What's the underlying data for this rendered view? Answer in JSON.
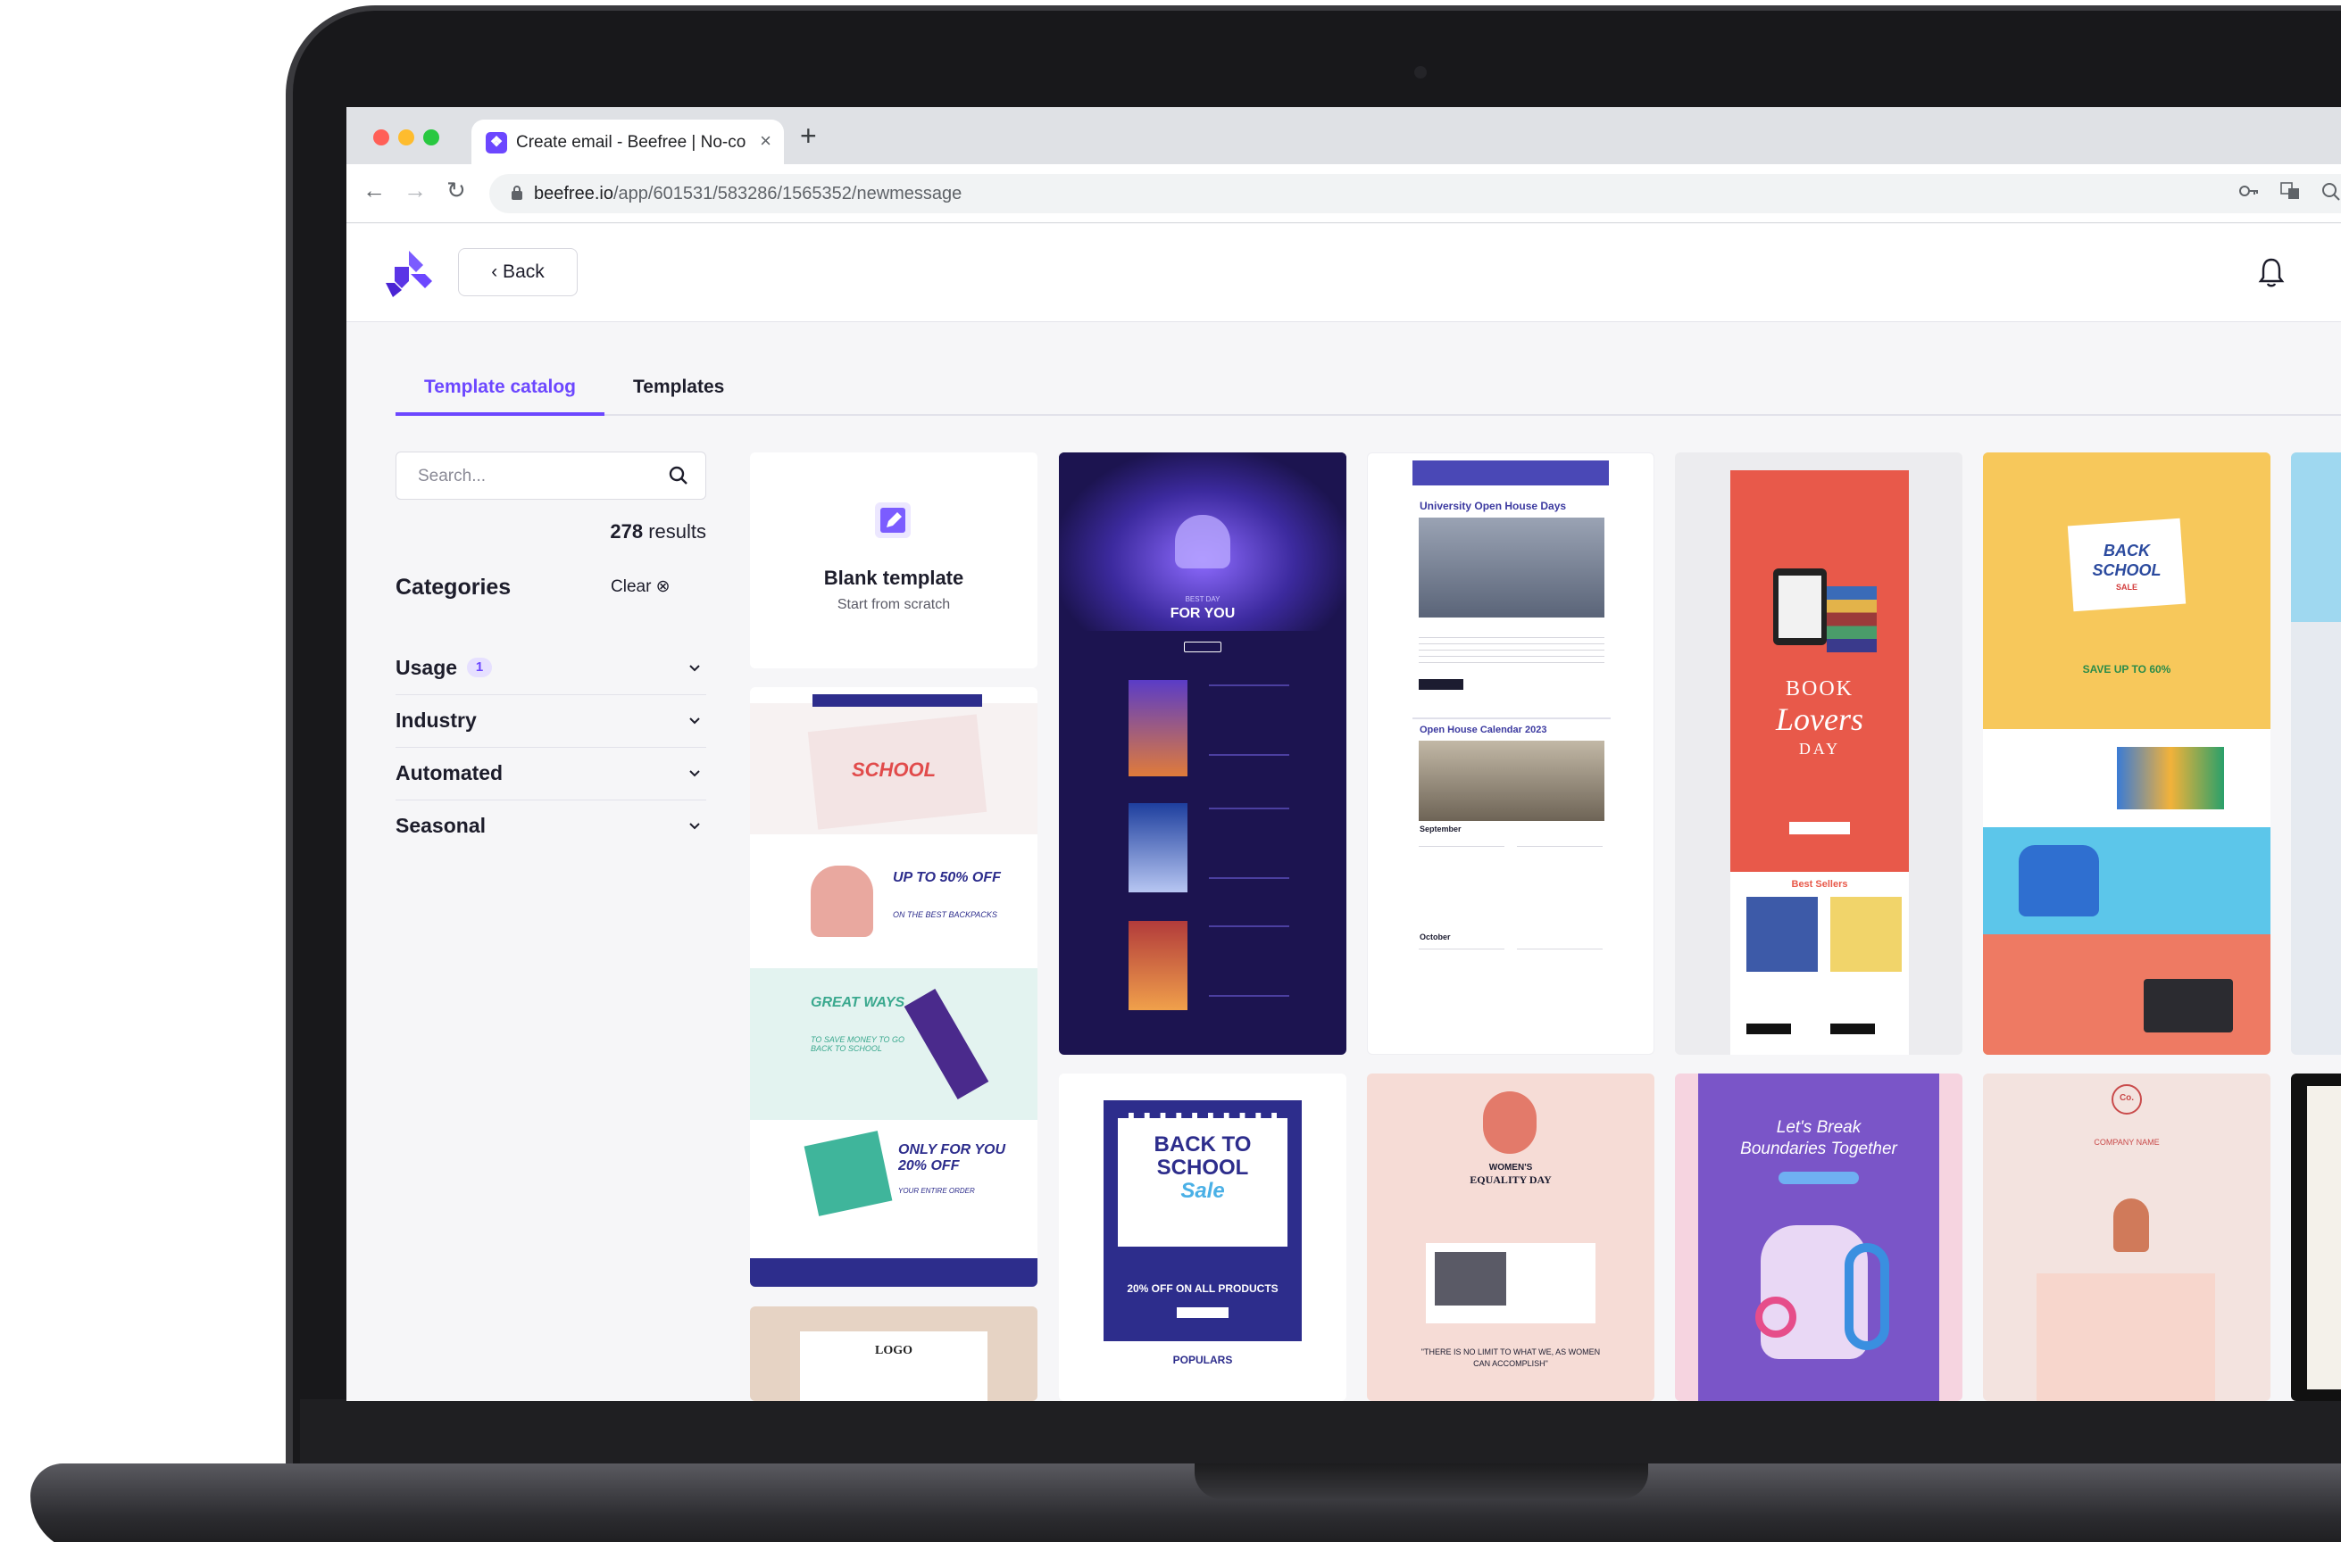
{
  "browser": {
    "tab_title": "Create email - Beefree | No-co",
    "tab_close": "×",
    "new_tab": "+",
    "url_domain": "beefree.io",
    "url_path": "/app/601531/583286/1565352/newmessage"
  },
  "header": {
    "back_label": "‹ Back"
  },
  "tabs": [
    {
      "label": "Template catalog",
      "active": true
    },
    {
      "label": "Templates",
      "active": false
    }
  ],
  "sidebar": {
    "search_placeholder": "Search...",
    "results_count": "278",
    "results_label": " results",
    "categories_title": "Categories",
    "clear_label": "Clear ⊗",
    "filters": [
      {
        "label": "Usage",
        "badge": "1"
      },
      {
        "label": "Industry"
      },
      {
        "label": "Automated"
      },
      {
        "label": "Seasonal"
      }
    ]
  },
  "blank_template": {
    "title": "Blank template",
    "subtitle": "Start from scratch"
  },
  "templates": {
    "game": {
      "headline": "FOR YOU",
      "sub": "BEST DAY"
    },
    "university": {
      "title": "University Open House Days",
      "section": "Open House Calendar 2023",
      "month1": "September",
      "month2": "October"
    },
    "book": {
      "line1": "BOOK",
      "line2": "Lovers",
      "line3": "DAY",
      "section": "Best Sellers"
    },
    "bts_yellow": {
      "line1": "BACK",
      "line2": "SCHOOL",
      "tag": "SALE",
      "offer": "SAVE UP TO 60%"
    },
    "school_pink": {
      "headline": "SCHOOL",
      "offer1": "UP TO 50% OFF",
      "offer1b": "ON THE BEST BACKPACKS",
      "great": "GREAT WAYS",
      "great2": "TO SAVE MONEY TO GO BACK TO SCHOOL",
      "offer2": "ONLY FOR YOU 20% OFF",
      "offer2b": "YOUR ENTIRE ORDER"
    },
    "bts_blue": {
      "line1": "BACK TO",
      "line2": "SCHOOL",
      "line3": "Sale",
      "offer": "20% OFF ON ALL PRODUCTS",
      "section": "POPULARS"
    },
    "equality": {
      "title": "WOMEN'S",
      "title2": "EQUALITY DAY",
      "quote": "\"THERE IS NO LIMIT TO WHAT WE, AS WOMEN CAN ACCOMPLISH\""
    },
    "boundaries": {
      "line1": "Let's Break",
      "line2": "Boundaries Together"
    },
    "company": {
      "name": "COMPANY NAME",
      "logo": "Co."
    },
    "logo_card": {
      "text": "LOGO"
    }
  },
  "colors": {
    "accent": "#6c47ff",
    "text": "#1d1d2b"
  }
}
